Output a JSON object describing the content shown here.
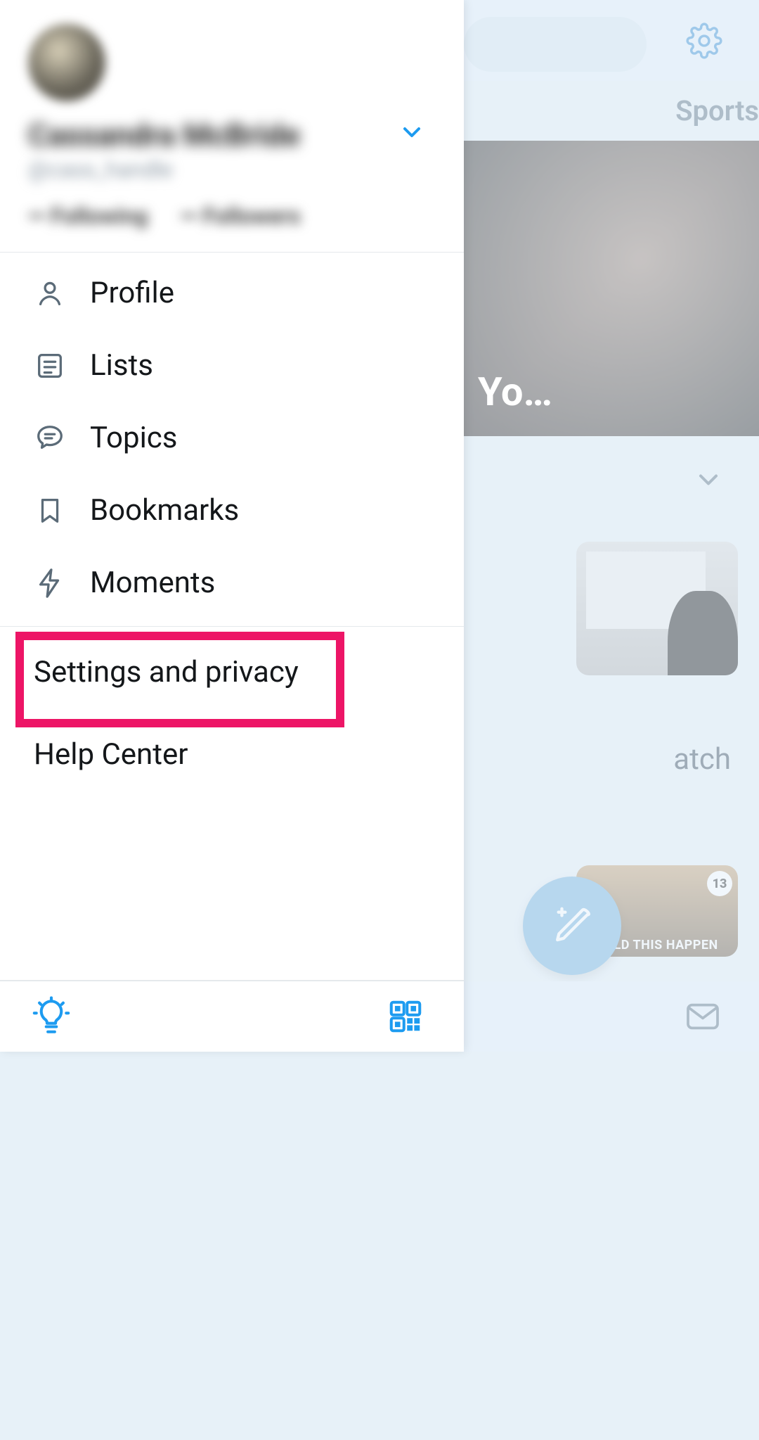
{
  "account": {
    "display_name": "Cassandra McBride",
    "handle": "@cass_handle",
    "following_label": "Following",
    "followers_label": "Followers"
  },
  "drawer": {
    "profile": "Profile",
    "lists": "Lists",
    "topics": "Topics",
    "bookmarks": "Bookmarks",
    "moments": "Moments",
    "settings": "Settings and privacy",
    "help": "Help Center"
  },
  "background": {
    "tab_sports": "Sports",
    "hero_text": "Yo…",
    "hero_text_prefix": "",
    "watch_text": "atch",
    "card2_caption": "OULD THIS HAPPEN",
    "card2_badge": "13"
  },
  "icons": {
    "gear": "gear-icon",
    "chevron_down": "chevron-down-icon",
    "profile": "person-icon",
    "lists": "list-icon",
    "topics": "topic-icon",
    "bookmarks": "bookmark-icon",
    "moments": "lightning-icon",
    "bulb": "bulb-icon",
    "qr": "qr-icon",
    "mail": "mail-icon",
    "compose": "compose-icon"
  },
  "colors": {
    "accent": "#1d9bf0",
    "highlight": "#ed1566",
    "icon_gray": "#5b6b78"
  },
  "highlight_target": "settings-and-privacy"
}
